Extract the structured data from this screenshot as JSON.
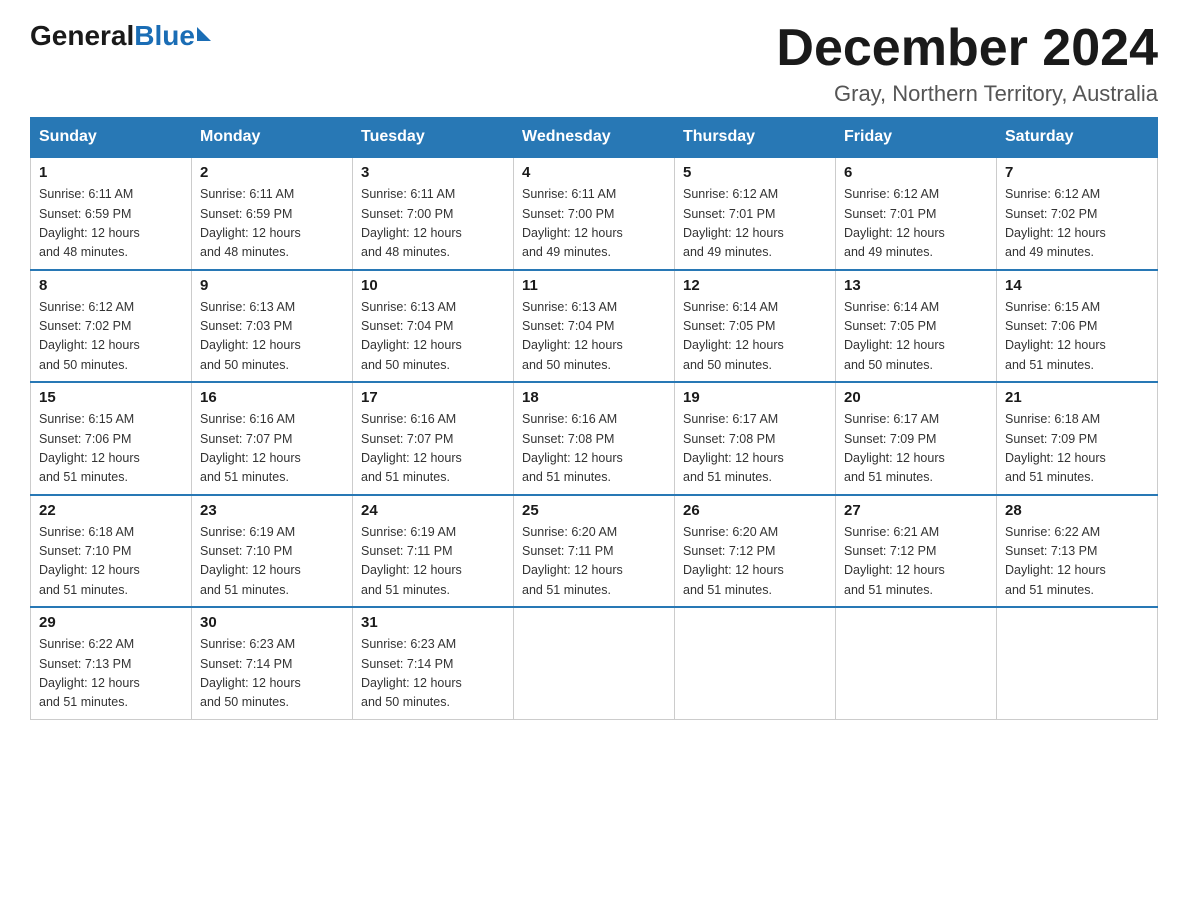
{
  "header": {
    "logo": {
      "general": "General",
      "blue": "Blue",
      "triangle": true
    },
    "title": "December 2024",
    "location": "Gray, Northern Territory, Australia"
  },
  "days_of_week": [
    "Sunday",
    "Monday",
    "Tuesday",
    "Wednesday",
    "Thursday",
    "Friday",
    "Saturday"
  ],
  "weeks": [
    [
      {
        "day": "1",
        "sunrise": "6:11 AM",
        "sunset": "6:59 PM",
        "daylight": "12 hours and 48 minutes."
      },
      {
        "day": "2",
        "sunrise": "6:11 AM",
        "sunset": "6:59 PM",
        "daylight": "12 hours and 48 minutes."
      },
      {
        "day": "3",
        "sunrise": "6:11 AM",
        "sunset": "7:00 PM",
        "daylight": "12 hours and 48 minutes."
      },
      {
        "day": "4",
        "sunrise": "6:11 AM",
        "sunset": "7:00 PM",
        "daylight": "12 hours and 49 minutes."
      },
      {
        "day": "5",
        "sunrise": "6:12 AM",
        "sunset": "7:01 PM",
        "daylight": "12 hours and 49 minutes."
      },
      {
        "day": "6",
        "sunrise": "6:12 AM",
        "sunset": "7:01 PM",
        "daylight": "12 hours and 49 minutes."
      },
      {
        "day": "7",
        "sunrise": "6:12 AM",
        "sunset": "7:02 PM",
        "daylight": "12 hours and 49 minutes."
      }
    ],
    [
      {
        "day": "8",
        "sunrise": "6:12 AM",
        "sunset": "7:02 PM",
        "daylight": "12 hours and 50 minutes."
      },
      {
        "day": "9",
        "sunrise": "6:13 AM",
        "sunset": "7:03 PM",
        "daylight": "12 hours and 50 minutes."
      },
      {
        "day": "10",
        "sunrise": "6:13 AM",
        "sunset": "7:04 PM",
        "daylight": "12 hours and 50 minutes."
      },
      {
        "day": "11",
        "sunrise": "6:13 AM",
        "sunset": "7:04 PM",
        "daylight": "12 hours and 50 minutes."
      },
      {
        "day": "12",
        "sunrise": "6:14 AM",
        "sunset": "7:05 PM",
        "daylight": "12 hours and 50 minutes."
      },
      {
        "day": "13",
        "sunrise": "6:14 AM",
        "sunset": "7:05 PM",
        "daylight": "12 hours and 50 minutes."
      },
      {
        "day": "14",
        "sunrise": "6:15 AM",
        "sunset": "7:06 PM",
        "daylight": "12 hours and 51 minutes."
      }
    ],
    [
      {
        "day": "15",
        "sunrise": "6:15 AM",
        "sunset": "7:06 PM",
        "daylight": "12 hours and 51 minutes."
      },
      {
        "day": "16",
        "sunrise": "6:16 AM",
        "sunset": "7:07 PM",
        "daylight": "12 hours and 51 minutes."
      },
      {
        "day": "17",
        "sunrise": "6:16 AM",
        "sunset": "7:07 PM",
        "daylight": "12 hours and 51 minutes."
      },
      {
        "day": "18",
        "sunrise": "6:16 AM",
        "sunset": "7:08 PM",
        "daylight": "12 hours and 51 minutes."
      },
      {
        "day": "19",
        "sunrise": "6:17 AM",
        "sunset": "7:08 PM",
        "daylight": "12 hours and 51 minutes."
      },
      {
        "day": "20",
        "sunrise": "6:17 AM",
        "sunset": "7:09 PM",
        "daylight": "12 hours and 51 minutes."
      },
      {
        "day": "21",
        "sunrise": "6:18 AM",
        "sunset": "7:09 PM",
        "daylight": "12 hours and 51 minutes."
      }
    ],
    [
      {
        "day": "22",
        "sunrise": "6:18 AM",
        "sunset": "7:10 PM",
        "daylight": "12 hours and 51 minutes."
      },
      {
        "day": "23",
        "sunrise": "6:19 AM",
        "sunset": "7:10 PM",
        "daylight": "12 hours and 51 minutes."
      },
      {
        "day": "24",
        "sunrise": "6:19 AM",
        "sunset": "7:11 PM",
        "daylight": "12 hours and 51 minutes."
      },
      {
        "day": "25",
        "sunrise": "6:20 AM",
        "sunset": "7:11 PM",
        "daylight": "12 hours and 51 minutes."
      },
      {
        "day": "26",
        "sunrise": "6:20 AM",
        "sunset": "7:12 PM",
        "daylight": "12 hours and 51 minutes."
      },
      {
        "day": "27",
        "sunrise": "6:21 AM",
        "sunset": "7:12 PM",
        "daylight": "12 hours and 51 minutes."
      },
      {
        "day": "28",
        "sunrise": "6:22 AM",
        "sunset": "7:13 PM",
        "daylight": "12 hours and 51 minutes."
      }
    ],
    [
      {
        "day": "29",
        "sunrise": "6:22 AM",
        "sunset": "7:13 PM",
        "daylight": "12 hours and 51 minutes."
      },
      {
        "day": "30",
        "sunrise": "6:23 AM",
        "sunset": "7:14 PM",
        "daylight": "12 hours and 50 minutes."
      },
      {
        "day": "31",
        "sunrise": "6:23 AM",
        "sunset": "7:14 PM",
        "daylight": "12 hours and 50 minutes."
      },
      null,
      null,
      null,
      null
    ]
  ],
  "labels": {
    "sunrise_prefix": "Sunrise: ",
    "sunset_prefix": "Sunset: ",
    "daylight_prefix": "Daylight: "
  }
}
